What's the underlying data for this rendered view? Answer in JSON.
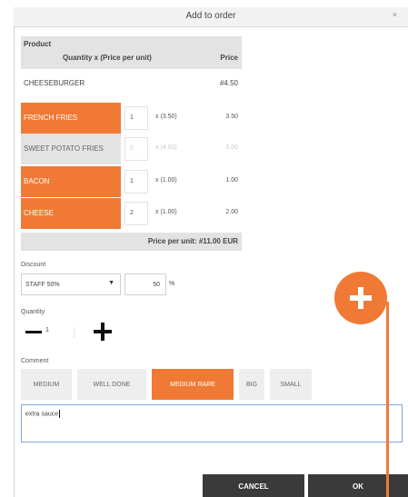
{
  "dialog": {
    "title": "Add to order",
    "close": "×"
  },
  "table": {
    "header": {
      "product": "Product",
      "qty": "Quantity x (Price per unit)",
      "price": "Price"
    },
    "main_item": {
      "name": "CHEESEBURGER",
      "price": "#4.50"
    },
    "options": [
      {
        "name": "FRENCH FRIES",
        "qty": "1",
        "unit": "x (3.50)",
        "price": "3.50",
        "selected": true
      },
      {
        "name": "SWEET POTATO FRIES",
        "qty": "0",
        "unit": "x (4.00)",
        "price": "0.00",
        "selected": false
      },
      {
        "name": "BACON",
        "qty": "1",
        "unit": "x (1.00)",
        "price": "1.00",
        "selected": true
      },
      {
        "name": "CHEESE",
        "qty": "2",
        "unit": "x (1.00)",
        "price": "2.00",
        "selected": true
      }
    ],
    "unit_total": "Price per unit: #11.00 EUR"
  },
  "discount": {
    "label": "Discount",
    "selected": "STAFF 50%",
    "percent": "50",
    "percent_sign": "%"
  },
  "quantity": {
    "label": "Quantity",
    "value": "1"
  },
  "comment": {
    "label": "Comment",
    "presets": [
      "MEDIUM",
      "WELL DONE",
      "MEDIUM RARE",
      "BIG",
      "SMALL"
    ],
    "selected": "MEDIUM RARE",
    "text": "extra sauce"
  },
  "buttons": {
    "cancel": "CANCEL",
    "ok": "OK"
  },
  "colors": {
    "accent": "#f07a35",
    "button": "#3a3a3a"
  }
}
